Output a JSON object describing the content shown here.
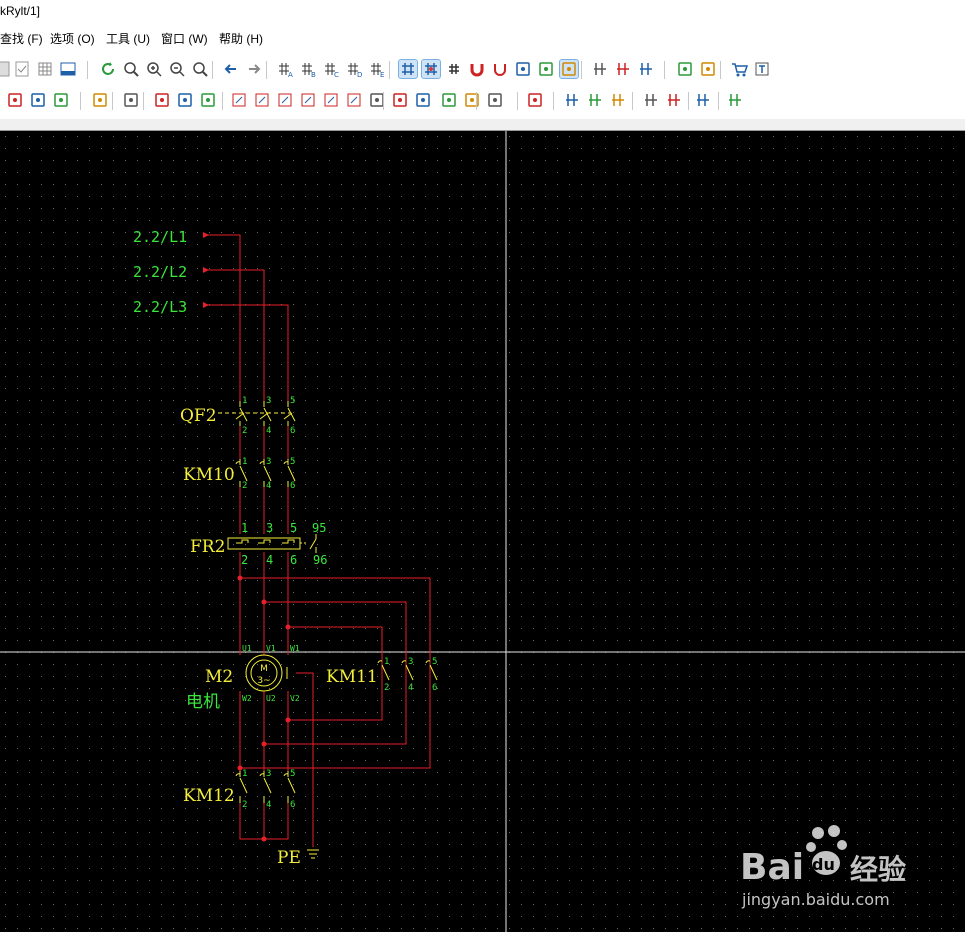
{
  "window": {
    "title": "kRylt/1]"
  },
  "menu": [
    {
      "label": "查找 (F)"
    },
    {
      "label": "选项 (O)"
    },
    {
      "label": "工具 (U)"
    },
    {
      "label": "窗口 (W)"
    },
    {
      "label": "帮助 (H)"
    }
  ],
  "toolbar1_icons": [
    "page-icon",
    "check-icon",
    "grid-table-icon",
    "window-icon",
    "refresh-icon",
    "zoom-fit-icon",
    "zoom-in-icon",
    "zoom-out-icon",
    "zoom-100-icon",
    "arrow-left-icon",
    "arrow-right-icon",
    "grid-a-icon",
    "grid-b-icon",
    "grid-c-icon",
    "grid-d-icon",
    "grid-e-icon",
    "grid-icon",
    "snap-grid-icon",
    "hash-icon",
    "magnet-icon",
    "magnet-a-icon",
    "link-icon",
    "component-icon",
    "ruler-icon",
    "wire-style-icon",
    "wire-style-2-icon",
    "wire-style-3-icon",
    "terminal-icon",
    "select-box-icon",
    "cart-icon",
    "text-icon"
  ],
  "toolbar2_icons": [
    "new-page-icon",
    "page-back-icon",
    "page-forward-icon",
    "block-icon",
    "component-grid-icon",
    "part-icon",
    "part-2-icon",
    "part-3-icon",
    "contact-icon",
    "contact-2-icon",
    "contact-3-icon",
    "contact-4-icon",
    "contact-5-icon",
    "contact-6-icon",
    "wave-icon",
    "coil-icon",
    "coil-2-icon",
    "flag-icon",
    "hatch-icon",
    "frame-icon",
    "table-icon",
    "wire-parallel-icon",
    "wire-cross-icon",
    "wire-branch-icon",
    "wire-angle-icon",
    "wire-node-icon",
    "wire-junction-icon",
    "wire-arrow-icon"
  ],
  "schematic": {
    "signals": [
      "2.2/L1",
      "2.2/L2",
      "2.2/L3"
    ],
    "components": {
      "qf2": "QF2",
      "km10": "KM10",
      "fr2": "FR2",
      "m2": "M2",
      "motor_desc": "电机",
      "km11": "KM11",
      "km12": "KM12",
      "pe": "PE"
    },
    "motor_symbol": {
      "top": "M",
      "bottom": "3~"
    },
    "pins_main": [
      "1",
      "3",
      "5",
      "2",
      "4",
      "6"
    ],
    "pins_fr2_aux": [
      "95",
      "96"
    ],
    "motor_terminals": [
      "U1",
      "V1",
      "W1",
      "W2",
      "U2",
      "V2"
    ]
  },
  "watermark": {
    "brand": "Bai",
    "brand2": "经验",
    "url": "jingyan.baidu.com"
  },
  "colors": {
    "canvas": "#000000",
    "wire": "#e8202a",
    "label": "#f4ee3a",
    "pin": "#39e639",
    "device": "#f4ee3a",
    "crosshair": "#e6e6e6"
  }
}
